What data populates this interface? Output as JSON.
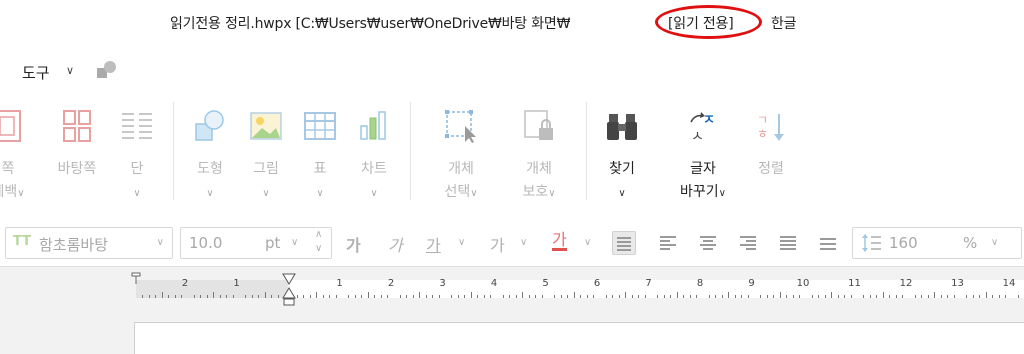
{
  "titlebar": {
    "document": "읽기전용 정리.hwpx [C:₩Users₩user₩OneDrive₩바탕 화면₩",
    "mode": "[읽기 전용]",
    "app": "한글"
  },
  "menu": {
    "tools": "도구"
  },
  "ribbon": {
    "items": [
      {
        "label1": "쪽",
        "label2": "테백"
      },
      {
        "label1": "바탕쪽"
      },
      {
        "label1": "단"
      },
      {
        "label1": "도형"
      },
      {
        "label1": "그림"
      },
      {
        "label1": "표"
      },
      {
        "label1": "차트"
      },
      {
        "label1": "개체",
        "label2": "선택"
      },
      {
        "label1": "개체",
        "label2": "보호"
      },
      {
        "label1": "찾기"
      },
      {
        "label1": "글자",
        "label2": "바꾸기"
      },
      {
        "label1": "정렬"
      }
    ]
  },
  "format": {
    "font_name": "함초롬바탕",
    "font_size": "10.0",
    "size_unit": "pt",
    "glyph": "가",
    "line_spacing": "160",
    "line_unit": "%"
  },
  "ruler": {
    "labels": [
      "2",
      "1",
      "1",
      "2",
      "3",
      "4",
      "5",
      "6",
      "7",
      "8",
      "9",
      "10",
      "11",
      "12",
      "13",
      "14"
    ]
  },
  "colors": {
    "accent": "#e01010",
    "find_blue": "#1565c0",
    "font_color_red": "#e05050"
  }
}
